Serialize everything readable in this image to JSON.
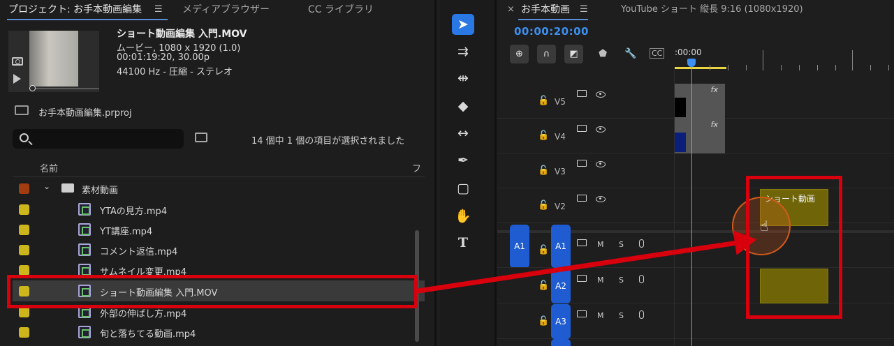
{
  "project_panel": {
    "tabs": [
      {
        "label": "プロジェクト: お手本動画編集"
      },
      {
        "label": "メディアブラウザー"
      },
      {
        "label": "CC ライブラリ"
      }
    ],
    "clip_info": {
      "title": "ショート動画編集 入門.MOV",
      "line1": "ムービー, 1080 x 1920 (1.0)",
      "line2": "00:01:19:20, 30.00p",
      "line3": "44100 Hz - 圧縮 - ステレオ"
    },
    "project_file": "お手本動画編集.prproj",
    "search_placeholder": "",
    "status": "14 個中 1 個の項目が選択されました",
    "columns": {
      "name": "名前",
      "fr": "フ"
    },
    "folder": {
      "label": "素材動画",
      "color": "#a33d0f"
    },
    "items": [
      {
        "label": "YTAの見方.mp4",
        "color": "#cdb61c"
      },
      {
        "label": "YT講座.mp4",
        "color": "#cdb61c"
      },
      {
        "label": "コメント返信.mp4",
        "color": "#cdb61c"
      },
      {
        "label": "サムネイル変更.mp4",
        "color": "#cdb61c"
      },
      {
        "label": "ショート動画編集 入門.MOV",
        "color": "#cdb61c"
      },
      {
        "label": "外部の伸ばし方.mp4",
        "color": "#cdb61c"
      },
      {
        "label": "旬と落ちてる動画.mp4",
        "color": "#cdb61c"
      }
    ]
  },
  "tools": [
    "selection-tool",
    "track-select-tool",
    "ripple-edit-tool",
    "razor-tool",
    "slip-tool",
    "pen-tool",
    "rectangle-tool",
    "hand-tool",
    "type-tool"
  ],
  "timeline": {
    "tab_label": "お手本動画",
    "close_label": "×",
    "sequence_label": "YouTube ショート 縦長 9:16 (1080x1920)",
    "timecode": "00:00:20:00",
    "ruler_start": ":00:00",
    "tracks_video": [
      {
        "name": "V5"
      },
      {
        "name": "V4"
      },
      {
        "name": "V3"
      },
      {
        "name": "V2"
      }
    ],
    "tracks_audio": [
      {
        "name": "A1",
        "source": "A1"
      },
      {
        "name": "A2"
      },
      {
        "name": "A3"
      }
    ],
    "m_label": "M",
    "s_label": "S",
    "fx_label": "fx",
    "clip_v2_label": "ショート動画"
  },
  "colors": {
    "accent": "#2a78e4",
    "timecode": "#3d8ff0",
    "label_yellow": "#cdb61c",
    "annotation_red": "#d9000e"
  }
}
